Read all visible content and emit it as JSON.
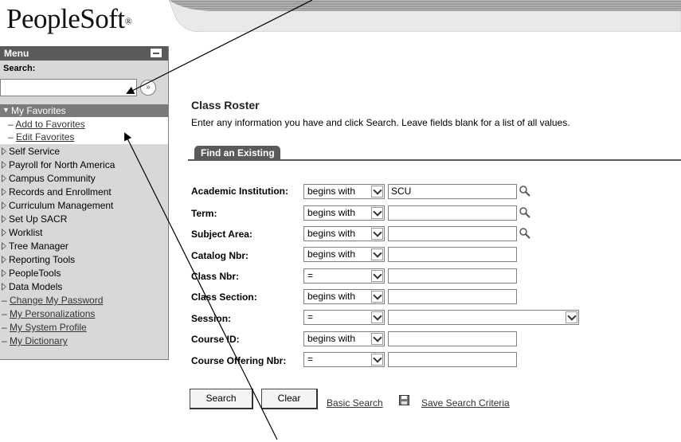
{
  "app": {
    "logo_text": "PeopleSoft",
    "logo_mark": "®"
  },
  "sidebar": {
    "menu_title": "Menu",
    "search_label": "Search:",
    "search_value": "",
    "search_go_icon": "double-chevron-right-icon",
    "favorites": {
      "label": "My Favorites",
      "links": [
        "Add to Favorites",
        "Edit Favorites"
      ]
    },
    "folders": [
      "Self Service",
      "Payroll for North America",
      "Campus Community",
      "Records and Enrollment",
      "Curriculum Management",
      "Set Up SACR",
      "Worklist",
      "Tree Manager",
      "Reporting Tools",
      "PeopleTools",
      "Data Models"
    ],
    "links": [
      "Change My Password",
      "My Personalizations",
      "My System Profile",
      "My Dictionary"
    ]
  },
  "main": {
    "title": "Class Roster",
    "instructions": "Enter any information you have and click Search. Leave fields blank for a list of all values.",
    "tab_label": "Find an Existing Value",
    "fields": [
      {
        "label": "Academic Institution:",
        "operator": "begins with",
        "value": "SCU"
      },
      {
        "label": "Term:",
        "operator": "begins with",
        "value": ""
      },
      {
        "label": "Subject Area:",
        "operator": "begins with",
        "value": ""
      },
      {
        "label": "Catalog Nbr:",
        "operator": "begins with",
        "value": ""
      },
      {
        "label": "Class Nbr:",
        "operator": "=",
        "value": ""
      },
      {
        "label": "Class Section:",
        "operator": "begins with",
        "value": ""
      },
      {
        "label": "Session:",
        "operator": "=",
        "value": ""
      },
      {
        "label": "Course ID:",
        "operator": "begins with",
        "value": ""
      },
      {
        "label": "Course Offering Nbr:",
        "operator": "=",
        "value": ""
      }
    ],
    "buttons": {
      "search": "Search",
      "clear": "Clear"
    },
    "links": {
      "basic_search": "Basic Search",
      "save_search": "Save Search Criteria"
    }
  },
  "colors": {
    "sidebar_bg": "#d8d8d8",
    "menu_header_bg": "#5a5a5a",
    "favorites_bg": "#7a7a7a",
    "tab_bg": "#5a5a5a"
  }
}
